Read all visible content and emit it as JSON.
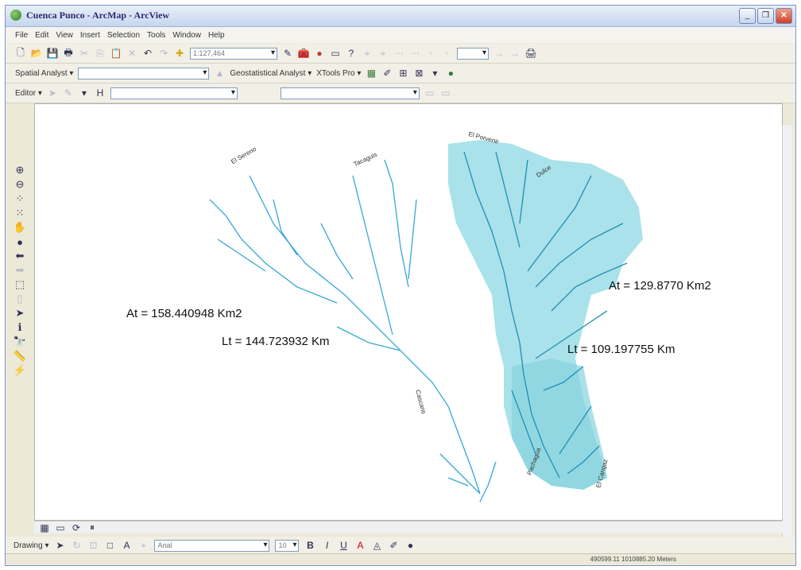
{
  "window": {
    "title": "Cuenca Punco - ArcMap - ArcView"
  },
  "menu": [
    "File",
    "Edit",
    "View",
    "Insert",
    "Selection",
    "Tools",
    "Window",
    "Help"
  ],
  "toolbar1": {
    "scale": "1:127,464"
  },
  "toolbar2": {
    "spatial_analyst": "Spatial Analyst ▾",
    "geostatistical": "Geostatistical Analyst ▾",
    "xtools": "XTools Pro ▾"
  },
  "toolbar3": {
    "editor": "Editor ▾"
  },
  "map": {
    "left_basin": {
      "area": "At = 158.440948 Km2",
      "length": "Lt = 144.723932 Km"
    },
    "right_basin": {
      "area": "At = 129.8770 Km2",
      "length": "Lt = 109.197755 Km"
    },
    "stream_names": [
      "El Sereno",
      "Tacaguis",
      "El Porvenir",
      "Dulce",
      "Cascaris",
      "Pachagua",
      "El Cangaz"
    ]
  },
  "drawing": {
    "label": "Drawing ▾",
    "font": "Arial",
    "size": "10"
  },
  "status": {
    "coords": "490599.11  1010885.20 Meters"
  },
  "colors": {
    "river": "#36a7d4",
    "basin_fill": "#a9e2ea",
    "basin_fill_dark": "#87d3de"
  }
}
